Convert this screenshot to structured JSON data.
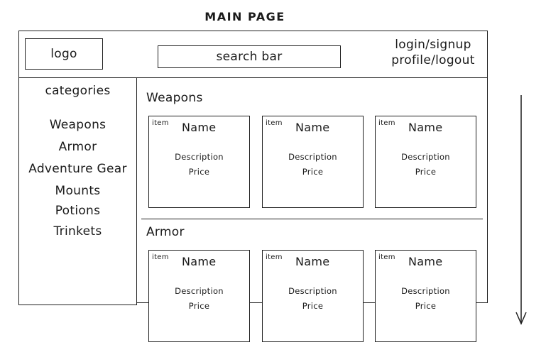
{
  "title": "MAIN PAGE",
  "header": {
    "logo": "logo",
    "search": "search bar",
    "auth_line1": "login/signup",
    "auth_line2": "profile/logout"
  },
  "sidebar": {
    "title": "categories",
    "items": [
      "Weapons",
      "Armor",
      "Adventure Gear",
      "Mounts",
      "Potions",
      "Trinkets"
    ]
  },
  "sections": [
    {
      "title": "Weapons",
      "cards": [
        {
          "tag": "item",
          "name": "Name",
          "description": "Description",
          "price": "Price"
        },
        {
          "tag": "item",
          "name": "Name",
          "description": "Description",
          "price": "Price"
        },
        {
          "tag": "item",
          "name": "Name",
          "description": "Description",
          "price": "Price"
        }
      ]
    },
    {
      "title": "Armor",
      "cards": [
        {
          "tag": "item",
          "name": "Name",
          "description": "Description",
          "price": "Price"
        },
        {
          "tag": "item",
          "name": "Name",
          "description": "Description",
          "price": "Price"
        },
        {
          "tag": "item",
          "name": "Name",
          "description": "Description",
          "price": "Price"
        }
      ]
    }
  ]
}
